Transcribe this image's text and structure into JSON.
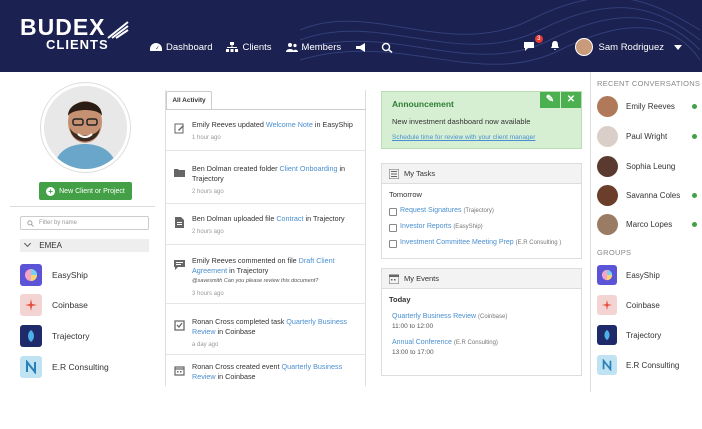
{
  "brand": {
    "line1": "BUDEX",
    "line2": "CLIENTS"
  },
  "nav": [
    {
      "label": "Dashboard",
      "icon": "dashboard-icon"
    },
    {
      "label": "Clients",
      "icon": "sitemap-icon"
    },
    {
      "label": "Members",
      "icon": "users-icon"
    }
  ],
  "header": {
    "notifications_count": "3",
    "user_name": "Sam Rodriguez"
  },
  "left": {
    "new_button": "New Client or Project",
    "filter_placeholder": "Filter by name",
    "region": "EMEA",
    "clients": [
      "EasyShip",
      "Coinbase",
      "Trajectory",
      "E.R Consulting"
    ]
  },
  "activity": {
    "tab": "All Activity",
    "items": [
      {
        "user": "Emily Reeves",
        "action": " updated ",
        "target": "Welcome Note",
        "rest": " in EasyShip",
        "comment": "",
        "time": "1 hour ago"
      },
      {
        "user": "Ben Dolman",
        "action": " created folder ",
        "target": "Client Onboarding",
        "rest": " in Trajectory",
        "comment": "",
        "time": "2 hours ago"
      },
      {
        "user": "Ben Dolman",
        "action": " uploaded file ",
        "target": "Contract",
        "rest": " in Trajectory",
        "comment": "",
        "time": "2 hours ago"
      },
      {
        "user": "Emily Reeves",
        "action": " commented on file ",
        "target": "Draft Client Agreement",
        "rest": " in Trajectory",
        "comment": "@savesmith Can you please review this document?",
        "time": "3 hours ago"
      },
      {
        "user": "Ronan Cross",
        "action": " completed task ",
        "target": "Quarterly Business Review",
        "rest": " in Coinbase",
        "comment": "",
        "time": "a day ago"
      },
      {
        "user": "Ronan Cross",
        "action": " created event ",
        "target": "Quarterly Business Review",
        "rest": " in Coinbase",
        "comment": "",
        "time": ""
      }
    ]
  },
  "announcement": {
    "title": "Announcement",
    "message": "New investment dashboard now available",
    "link": "Schedule time for review with your client manager"
  },
  "tasks": {
    "title": "My Tasks",
    "group": "Tomorrow",
    "items": [
      {
        "label": "Request Signatures",
        "client": "(Trajectory)"
      },
      {
        "label": "Investor Reports",
        "client": "(EasyShip)"
      },
      {
        "label": "Investment Committee Meeting Prep",
        "client": "(E.R Consulting )"
      }
    ]
  },
  "events": {
    "title": "My Events",
    "group": "Today",
    "items": [
      {
        "label": "Quarterly Business Review",
        "client": "(Coinbase)",
        "time": "11:00 to 12:00"
      },
      {
        "label": "Annual Conference",
        "client": "(E.R Consulting)",
        "time": "13:00 to 17:00"
      }
    ]
  },
  "right": {
    "conversations_title": "RECENT CONVERSATIONS",
    "conversations": [
      "Emily Reeves",
      "Paul Wright",
      "Sophia Leung",
      "Savanna Coles",
      "Marco Lopes"
    ],
    "groups_title": "GROUPS",
    "groups": [
      "EasyShip",
      "Coinbase",
      "Trajectory",
      "E.R Consulting"
    ]
  },
  "colors": {
    "header": "#1b2150",
    "accent_green": "#43a047",
    "link": "#4a8fd0"
  }
}
